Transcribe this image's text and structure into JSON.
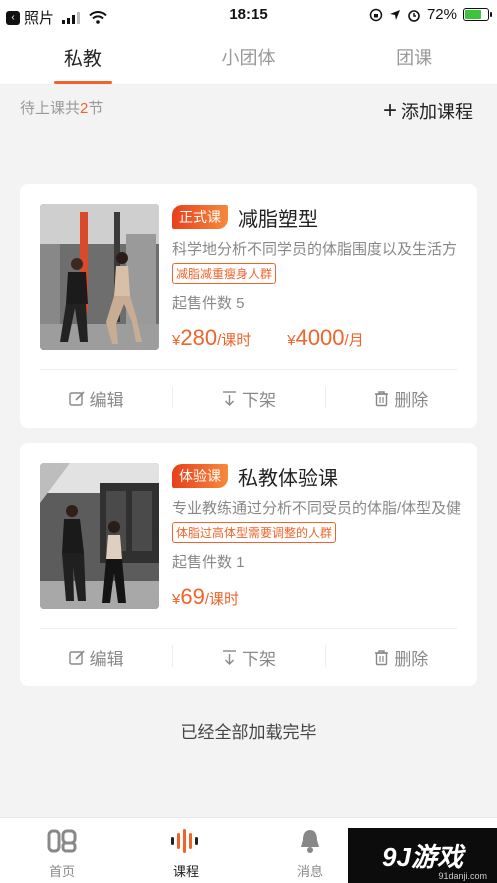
{
  "statusbar": {
    "back_app": "照片",
    "time": "18:15",
    "battery": "72%"
  },
  "tabs": [
    {
      "label": "私教"
    },
    {
      "label": "小团体"
    },
    {
      "label": "团课"
    }
  ],
  "summary": {
    "prefix": "待上课共",
    "count": "2",
    "suffix": "节"
  },
  "add_course": {
    "label": "添加课程"
  },
  "courses": [
    {
      "badge": "正式课",
      "title": "减脂塑型",
      "desc": "科学地分析不同学员的体脂围度以及生活方",
      "tag": "减脂减重瘦身人群",
      "sold": "起售件数 5",
      "prices": [
        {
          "currency": "¥",
          "amount": "280",
          "unit": "/课时"
        },
        {
          "currency": "¥",
          "amount": "4000",
          "unit": "/月"
        }
      ]
    },
    {
      "badge": "体验课",
      "title": "私教体验课",
      "desc": "专业教练通过分析不同受员的体脂/体型及健",
      "tag": "体脂过高体型需要调整的人群",
      "sold": "起售件数 1",
      "prices": [
        {
          "currency": "¥",
          "amount": "69",
          "unit": "/课时"
        }
      ]
    }
  ],
  "actions": {
    "edit": "编辑",
    "offshelf": "下架",
    "delete": "删除"
  },
  "loaded_text": "已经全部加载完毕",
  "bottom_nav": [
    {
      "label": "首页",
      "icon": "home-logo-icon"
    },
    {
      "label": "课程",
      "icon": "soundwave-icon"
    },
    {
      "label": "消息",
      "icon": "bell-icon"
    }
  ],
  "watermark": {
    "text": "9J游戏",
    "url": "91danji.com"
  },
  "colors": {
    "accent": "#f0632a",
    "battery": "#3cc43c"
  }
}
